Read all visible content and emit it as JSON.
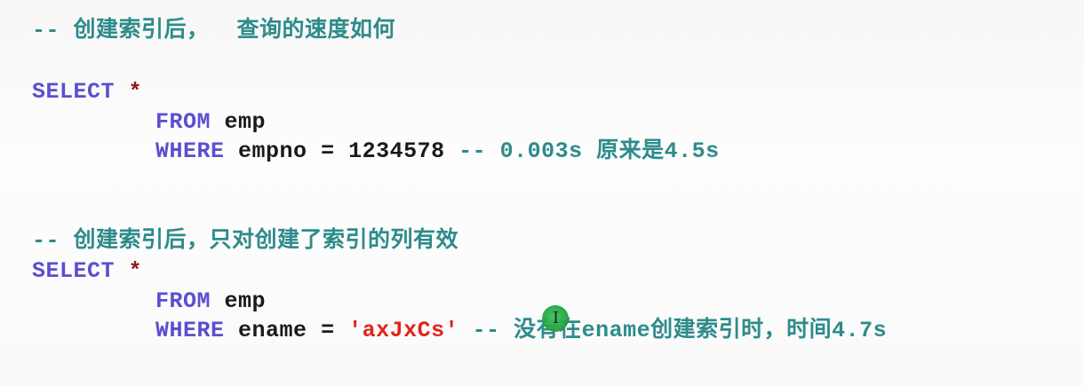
{
  "block1": {
    "comment": "-- 创建索引后，  查询的速度如何",
    "select_kw": "SELECT",
    "star": "*",
    "from_kw": "FROM",
    "from_table": "emp",
    "where_kw": "WHERE",
    "where_col": "empno",
    "where_op": "=",
    "where_val": "1234578",
    "trailing_comment": "-- 0.003s 原来是4.5s"
  },
  "block2": {
    "comment": "-- 创建索引后，只对创建了索引的列有效",
    "select_kw": "SELECT",
    "star": "*",
    "from_kw": "FROM",
    "from_table": "emp",
    "where_kw": "WHERE",
    "where_col": "ename",
    "where_op": "=",
    "where_val": "'axJxCs'",
    "trailing_comment": "-- 没有在ename创建索引时，时间4.7s"
  },
  "colors": {
    "comment": "#2e8b8b",
    "keyword": "#5a4fd1",
    "string": "#e0241b",
    "star": "#8b1a1a"
  },
  "icons": [
    "mouse-cursor-icon"
  ]
}
